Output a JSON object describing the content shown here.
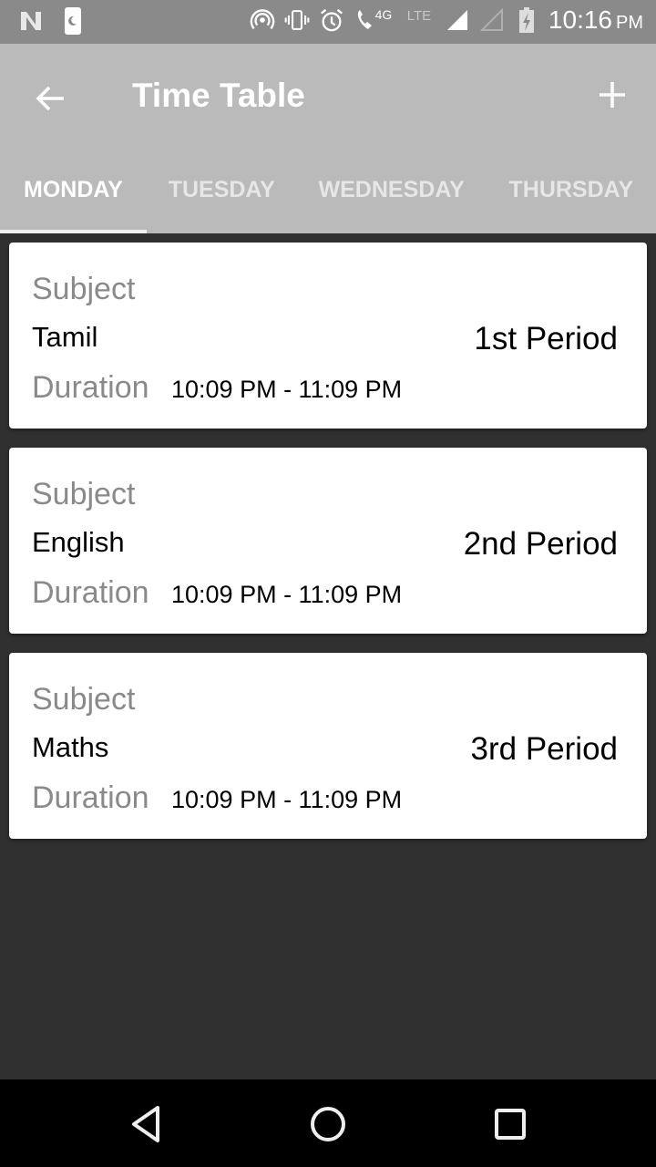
{
  "status_bar": {
    "left_icons": [
      "n-logo-icon",
      "do-not-disturb-icon"
    ],
    "right_icons": [
      "hotspot-icon",
      "vibrate-icon",
      "alarm-icon",
      "wifi-call-icon",
      "lte-disabled-icon",
      "signal-full-icon",
      "signal-empty-icon",
      "battery-charging-icon"
    ],
    "network_label": "4G",
    "lte_label": "LTE",
    "time": "10:16",
    "ampm": "PM"
  },
  "app_bar": {
    "title": "Time Table",
    "back_icon": "arrow-left-icon",
    "add_icon": "plus-icon"
  },
  "tabs": [
    {
      "label": "MONDAY",
      "active": true
    },
    {
      "label": "TUESDAY",
      "active": false
    },
    {
      "label": "WEDNESDAY",
      "active": false
    },
    {
      "label": "THURSDAY",
      "active": false
    }
  ],
  "cards": [
    {
      "subject_label": "Subject",
      "subject": "Tamil",
      "period": "1st Period",
      "duration_label": "Duration",
      "duration": "10:09 PM - 11:09 PM"
    },
    {
      "subject_label": "Subject",
      "subject": "English",
      "period": "2nd Period",
      "duration_label": "Duration",
      "duration": "10:09 PM - 11:09 PM"
    },
    {
      "subject_label": "Subject",
      "subject": "Maths",
      "period": "3rd Period",
      "duration_label": "Duration",
      "duration": "10:09 PM - 11:09 PM"
    }
  ],
  "nav_bar": {
    "back": "nav-back-icon",
    "home": "nav-home-icon",
    "recents": "nav-recents-icon"
  },
  "colors": {
    "status_bar": "#8a8a8a",
    "app_bar": "#bababa",
    "background": "#303030",
    "card": "#ffffff",
    "label_gray": "#8a8a8a"
  }
}
